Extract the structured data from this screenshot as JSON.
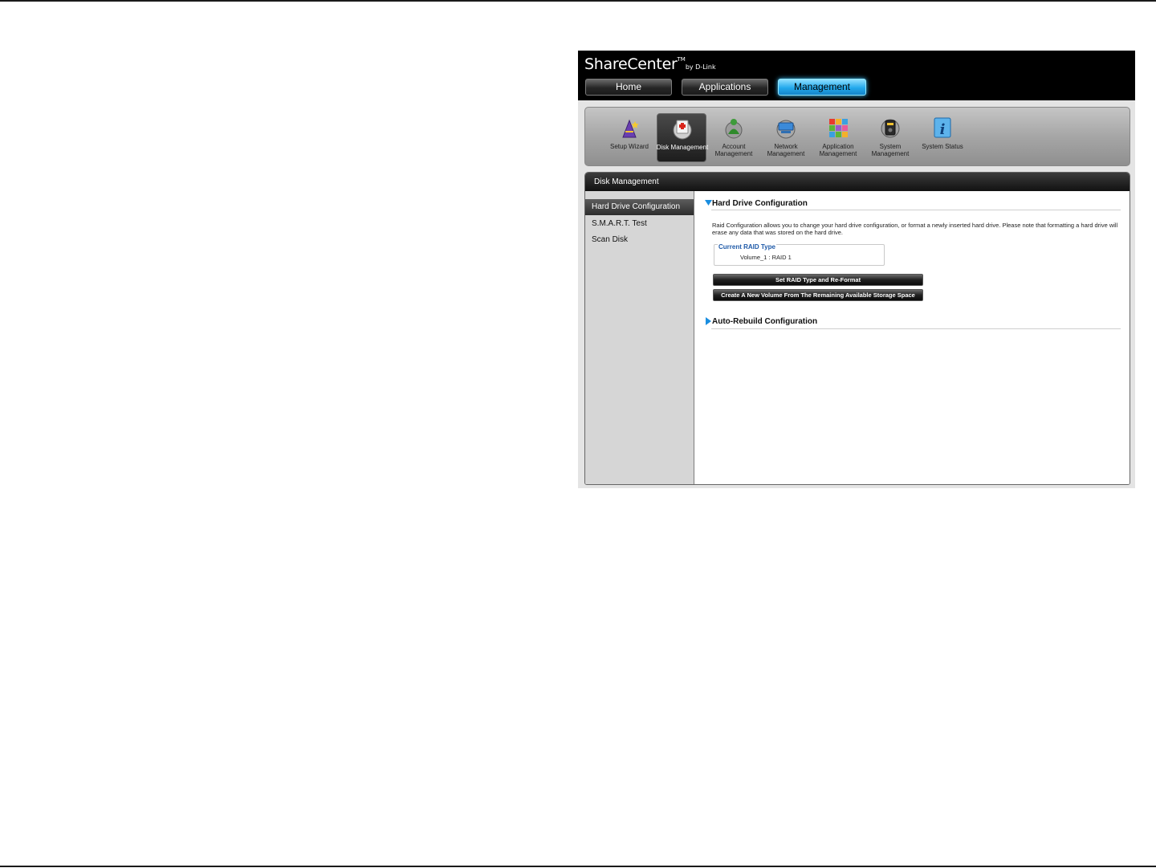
{
  "header": {
    "logo_main": "ShareCenter",
    "logo_tm": "TM",
    "logo_by": "by D-Link",
    "tabs": [
      {
        "label": "Home"
      },
      {
        "label": "Applications"
      },
      {
        "label": "Management"
      }
    ]
  },
  "toolbar": {
    "items": [
      {
        "label": "Setup Wizard",
        "icon": "wizard-icon"
      },
      {
        "label": "Disk Management",
        "icon": "disk-icon"
      },
      {
        "label": "Account Management",
        "icon": "account-icon"
      },
      {
        "label": "Network Management",
        "icon": "network-icon"
      },
      {
        "label": "Application Management",
        "icon": "application-icon"
      },
      {
        "label": "System Management",
        "icon": "system-icon"
      },
      {
        "label": "System Status",
        "icon": "info-icon"
      }
    ]
  },
  "panel": {
    "title": "Disk Management",
    "sidebar": [
      {
        "label": "Hard Drive Configuration"
      },
      {
        "label": "S.M.A.R.T. Test"
      },
      {
        "label": "Scan Disk"
      }
    ],
    "hdc": {
      "title": "Hard Drive Configuration",
      "description": "Raid Configuration allows you to change your hard drive configuration, or format a newly inserted hard drive. Please note that formatting a hard drive will erase any data that was stored on the hard drive.",
      "raid_legend": "Current RAID Type",
      "raid_value": "Volume_1 : RAID 1",
      "btn_set_raid": "Set RAID Type and Re-Format",
      "btn_new_volume": "Create A New Volume From The Remaining Available Storage Space"
    },
    "auto_rebuild": {
      "title": "Auto-Rebuild Configuration"
    }
  },
  "colors": {
    "accent": "#23a9ec",
    "link": "#1f5aa8"
  }
}
